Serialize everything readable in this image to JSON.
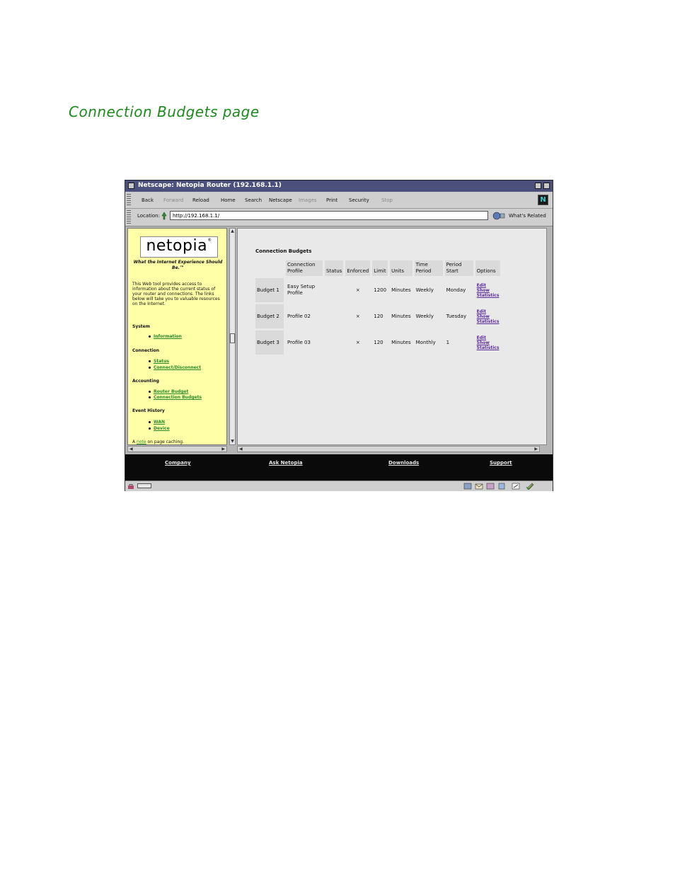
{
  "heading": "Connection Budgets page",
  "window": {
    "title": "Netscape: Netopia Router (192.168.1.1)",
    "toolbar": [
      {
        "label": "Back",
        "enabled": true
      },
      {
        "label": "Forward",
        "enabled": false
      },
      {
        "label": "Reload",
        "enabled": true
      },
      {
        "label": "Home",
        "enabled": true
      },
      {
        "label": "Search",
        "enabled": true
      },
      {
        "label": "Netscape",
        "enabled": true
      },
      {
        "label": "Images",
        "enabled": false
      },
      {
        "label": "Print",
        "enabled": true
      },
      {
        "label": "Security",
        "enabled": true
      },
      {
        "label": "Stop",
        "enabled": false
      }
    ],
    "logo_letter": "N",
    "location_label": "Location:",
    "url": "http://192.168.1.1/",
    "whats_related": "What's Related"
  },
  "sidebar": {
    "logo": "netopia",
    "logo_reg": "®",
    "tagline": "What the Internet Experience Should Be.™",
    "intro": "This Web tool provides access to information about the current status of your router and connections. The links below will take you to valuable resources on the Internet.",
    "sections": [
      {
        "heading": "System",
        "links": [
          "Information"
        ]
      },
      {
        "heading": "Connection",
        "links": [
          "Status",
          "Connect/Disconnect"
        ]
      },
      {
        "heading": "Accounting",
        "links": [
          "Router Budget",
          "Connection Budgets"
        ]
      },
      {
        "heading": "Event History",
        "links": [
          "WAN",
          "Device"
        ]
      }
    ],
    "note_prefix": "A",
    "note_link": "note",
    "note_suffix": "on page caching."
  },
  "main": {
    "title": "Connection Budgets",
    "columns": [
      "",
      "Connection Profile",
      "Status",
      "Enforced",
      "Limit",
      "Units",
      "Time Period",
      "Period Start",
      "Options"
    ],
    "rows": [
      {
        "name": "Budget 1",
        "profile": "Easy Setup Profile",
        "status": "",
        "enforced": "×",
        "limit": "1200",
        "units": "Minutes",
        "period": "Weekly",
        "start": "Monday"
      },
      {
        "name": "Budget 2",
        "profile": "Profile 02",
        "status": "",
        "enforced": "×",
        "limit": "120",
        "units": "Minutes",
        "period": "Weekly",
        "start": "Tuesday"
      },
      {
        "name": "Budget 3",
        "profile": "Profile 03",
        "status": "",
        "enforced": "×",
        "limit": "120",
        "units": "Minutes",
        "period": "Monthly",
        "start": "1"
      }
    ],
    "option_links": [
      "Edit",
      "Show",
      "Statistics"
    ]
  },
  "footer": [
    "Company",
    "Ask Netopia",
    "Downloads",
    "Support"
  ],
  "colors": {
    "heading": "#1e8a1e",
    "sidebar_bg": "#ffffa8",
    "sidebar_link": "#2a8a2a",
    "option_link": "#5a2a9a",
    "footer_bg": "#0a0a0a"
  }
}
